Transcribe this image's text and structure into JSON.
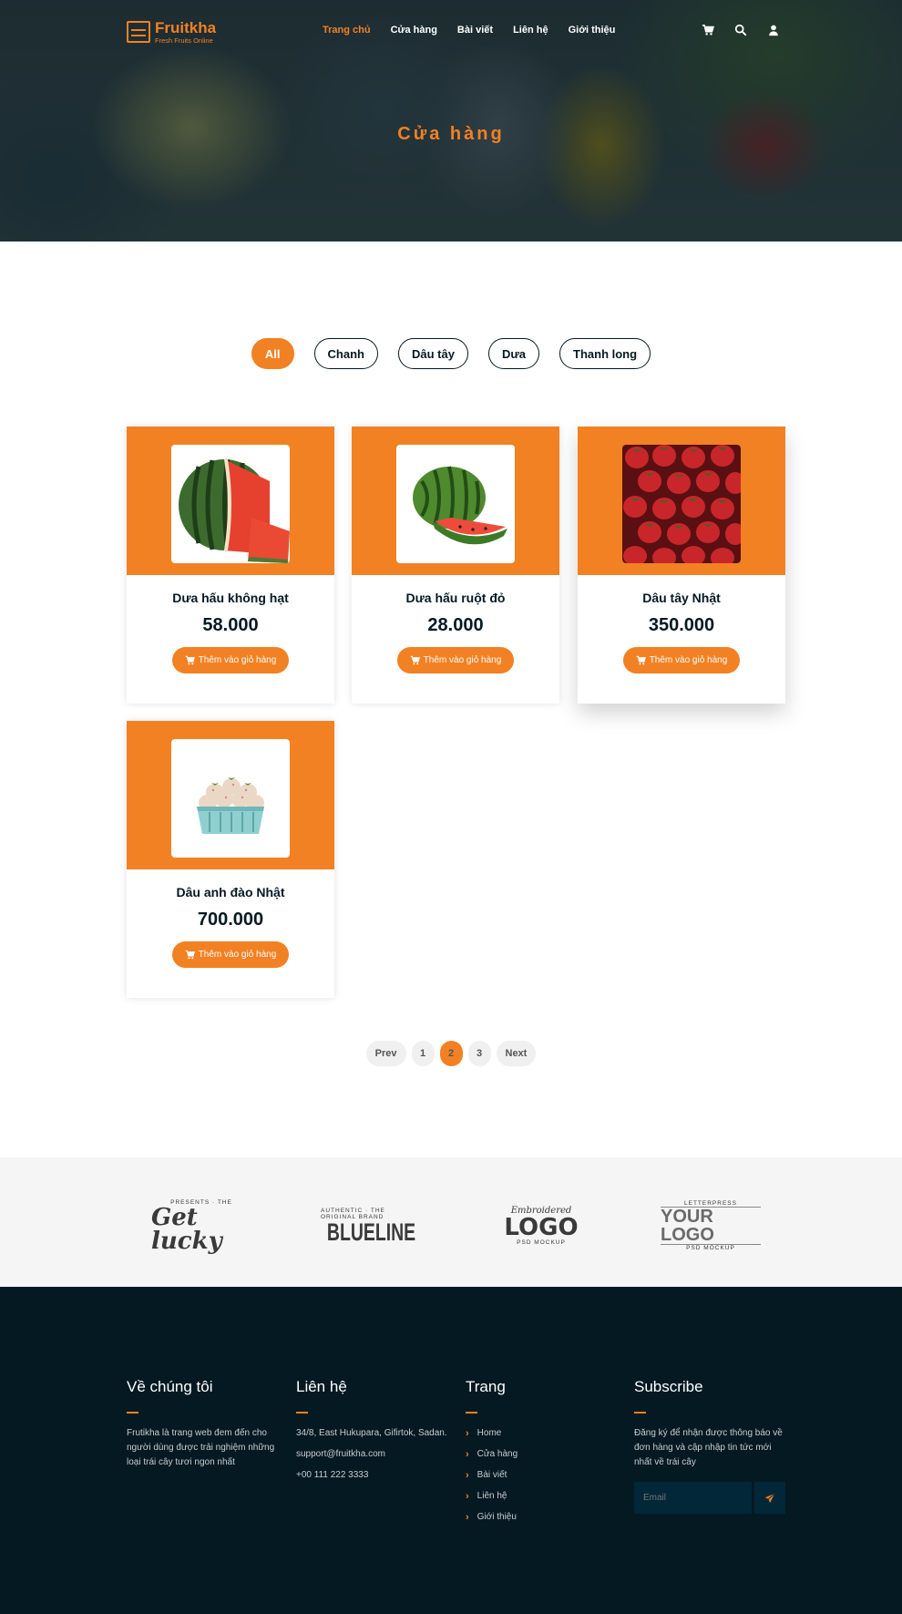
{
  "nav": {
    "logo_name": "Fruitkha",
    "logo_tagline": "Fresh Fruits Online",
    "menu": [
      "Trang chủ",
      "Cửa hàng",
      "Bài viết",
      "Liên hệ",
      "Giới thiệu"
    ],
    "active_menu": "Trang chủ",
    "icons": [
      "cart-icon",
      "search-icon",
      "user-icon"
    ]
  },
  "hero": {
    "title": "Cửa hàng"
  },
  "filters": {
    "items": [
      "All",
      "Chanh",
      "Dâu tây",
      "Dưa",
      "Thanh long"
    ],
    "active": "All"
  },
  "products": [
    {
      "name": "Dưa hấu không hạt",
      "price": "58.000",
      "button": "Thêm vào giỏ hàng",
      "image": "seedless-watermelon"
    },
    {
      "name": "Dưa hấu ruột đỏ",
      "price": "28.000",
      "button": "Thêm vào giỏ hàng",
      "image": "red-watermelon"
    },
    {
      "name": "Dâu tây Nhật",
      "price": "350.000",
      "button": "Thêm vào giỏ hàng",
      "image": "japanese-strawberry"
    },
    {
      "name": "Dâu anh đào Nhật",
      "price": "700.000",
      "button": "Thêm vào giỏ hàng",
      "image": "white-strawberry-basket"
    }
  ],
  "pagination": {
    "prev": "Prev",
    "pages": [
      "1",
      "2",
      "3"
    ],
    "current": "2",
    "next": "Next"
  },
  "brands": [
    {
      "top": "Presents · The",
      "main": "Get lucky",
      "bottom": ""
    },
    {
      "top": "Authentic · The Original Brand",
      "main": "BLUELINE",
      "bottom": ""
    },
    {
      "top": "Embroidered",
      "main": "LOGO",
      "bottom": "PSD MOCKUP"
    },
    {
      "top": "LETTERPRESS",
      "main": "YOUR LOGO",
      "bottom": "PSD MOCKUP"
    }
  ],
  "footer": {
    "about": {
      "title": "Về chúng tôi",
      "text": "Frutikha là trang web đem đến cho người dùng được trải nghiệm những loại trái cây tươi ngon nhất"
    },
    "contact": {
      "title": "Liên hệ",
      "address": "34/8, East Hukupara, Gifirtok, Sadan.",
      "email": "support@fruitkha.com",
      "phone": "+00 111 222 3333"
    },
    "pages": {
      "title": "Trang",
      "links": [
        "Home",
        "Cửa hàng",
        "Bài viết",
        "Liên hệ",
        "Giới thiệu"
      ]
    },
    "subscribe": {
      "title": "Subscribe",
      "text": "Đăng ký để nhận được thông báo về đơn hàng và cập nhập tin tức mới nhất về trái cây",
      "placeholder": "Email"
    }
  },
  "colors": {
    "accent": "#f28123",
    "dark": "#051922",
    "footer_input": "#012738"
  }
}
